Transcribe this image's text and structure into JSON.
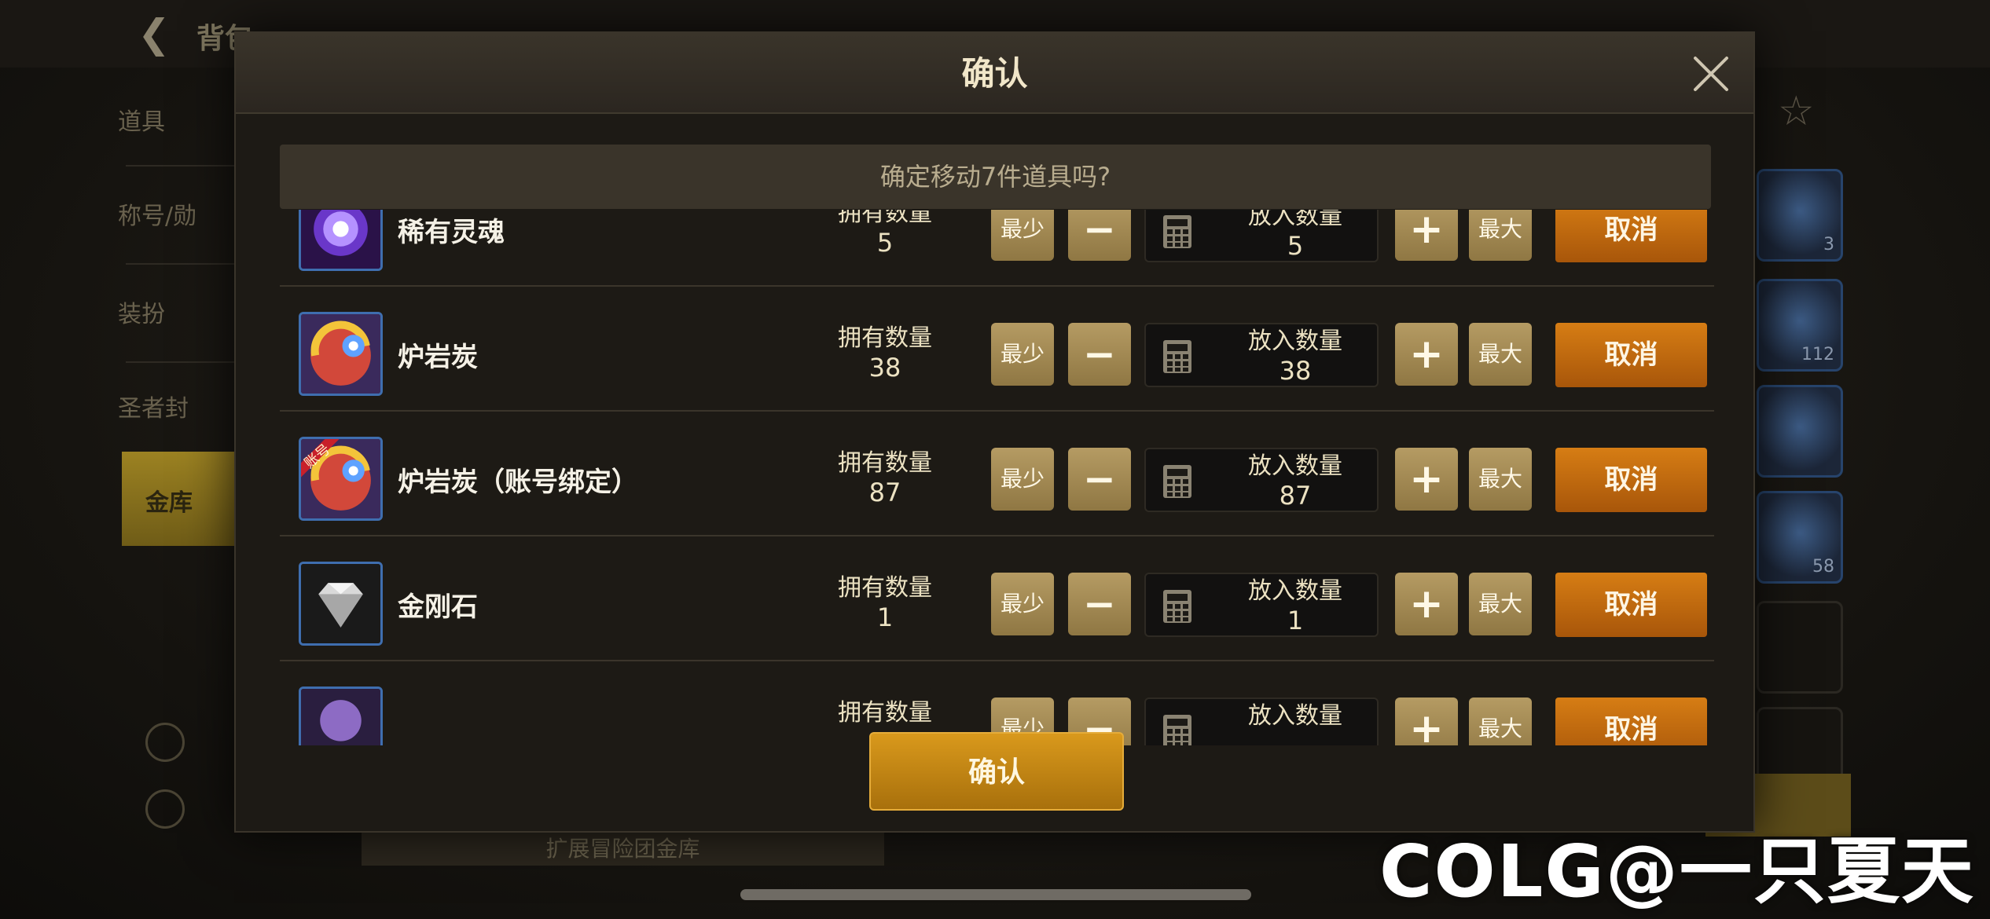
{
  "background": {
    "title": "背包",
    "sidebar": [
      "道具",
      "称号/勋",
      "装扮",
      "圣者封",
      "金库"
    ],
    "selected_sidebar": "金库",
    "slot_counts": [
      "3",
      "112",
      "",
      "58"
    ],
    "bottom_button": "扩展冒险团金库"
  },
  "dialog": {
    "title": "确认",
    "prompt": "确定移动7件道具吗?",
    "owned_label": "拥有数量",
    "put_label": "放入数量",
    "min_label": "最少",
    "minus_label": "−",
    "plus_label": "+",
    "max_label": "最大",
    "cancel_label": "取消",
    "confirm_label": "确认",
    "items": [
      {
        "name": "稀有灵魂",
        "owned": "5",
        "put": "5",
        "icon": "rare-soul-icon"
      },
      {
        "name": "炉岩炭",
        "owned": "38",
        "put": "38",
        "icon": "lava-coal-icon"
      },
      {
        "name": "炉岩炭（账号绑定）",
        "owned": "87",
        "put": "87",
        "icon": "lava-coal-bound-icon",
        "badge": "账号"
      },
      {
        "name": "金刚石",
        "owned": "1",
        "put": "1",
        "icon": "diamond-icon"
      },
      {
        "name": "",
        "owned": "",
        "put": "",
        "icon": "purple-orb-icon"
      }
    ]
  },
  "watermark": "COLG@一只夏天",
  "colors": {
    "accent": "#d67d14",
    "confirm": "#c9870f",
    "gold_button": "#a68a52"
  }
}
